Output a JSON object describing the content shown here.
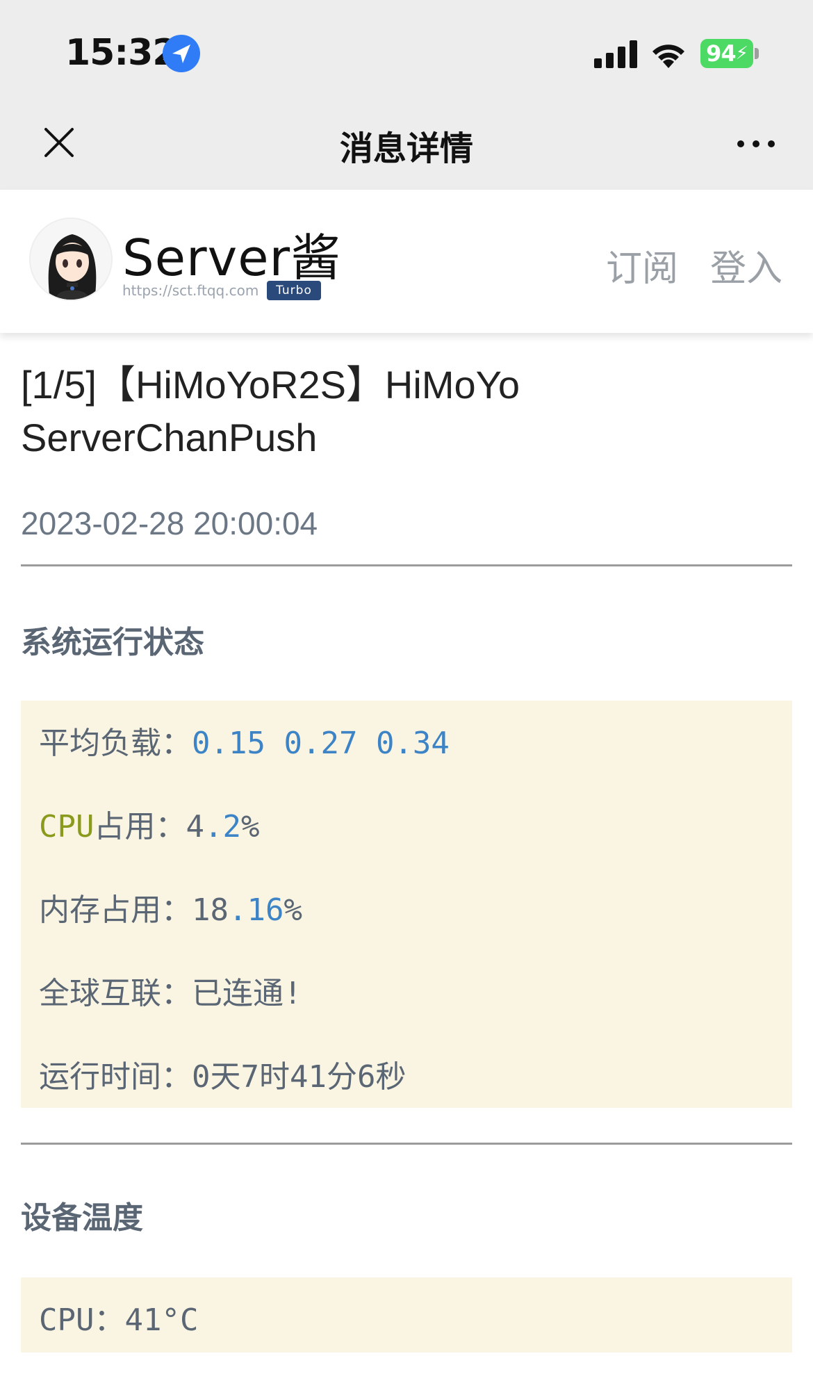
{
  "status_bar": {
    "time": "15:32",
    "battery": "94"
  },
  "nav": {
    "title": "消息详情"
  },
  "site": {
    "brand": "Server酱",
    "url": "https://sct.ftqq.com",
    "badge": "Turbo",
    "subscribe": "订阅",
    "login": "登入"
  },
  "message": {
    "title": "[1/5]【HiMoYoR2S】HiMoYo ServerChanPush",
    "time": "2023-02-28 20:00:04"
  },
  "system_status": {
    "heading": "系统运行状态",
    "load_label": "平均负载：",
    "load_values": [
      "0.15",
      "0.27",
      "0.34"
    ],
    "cpu_prefix": "CPU",
    "cpu_label": "占用：",
    "cpu_value_int": "4",
    "cpu_value_frac": ".2",
    "cpu_unit": "%",
    "mem_label": "内存占用：",
    "mem_value_int": "18",
    "mem_value_frac": ".16",
    "mem_unit": "%",
    "net_label": "全球互联：",
    "net_value": "已连通!",
    "uptime_label": "运行时间：",
    "uptime_value": "0天7时41分6秒"
  },
  "temperature": {
    "heading": "设备温度",
    "cpu_label": "CPU：",
    "cpu_value": "41°C"
  }
}
